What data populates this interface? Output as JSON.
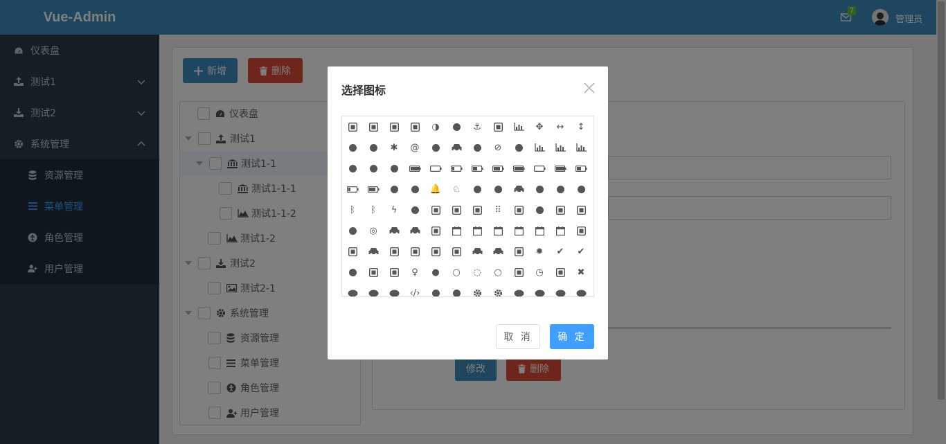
{
  "app": {
    "title": "Vue-Admin"
  },
  "sidebar": {
    "items": [
      {
        "label": "仪表盘",
        "icon": "dashboard-icon"
      },
      {
        "label": "测试1",
        "icon": "upload-icon"
      },
      {
        "label": "测试2",
        "icon": "download-icon"
      },
      {
        "label": "系统管理",
        "icon": "gear-icon"
      }
    ],
    "submenu": [
      {
        "label": "资源管理",
        "icon": "database-icon"
      },
      {
        "label": "菜单管理",
        "icon": "bars-icon",
        "active": true
      },
      {
        "label": "角色管理",
        "icon": "accessibility-icon"
      },
      {
        "label": "用户管理",
        "icon": "user-plus-icon"
      }
    ]
  },
  "header": {
    "mail_count": "7",
    "username": "管理员"
  },
  "toolbar": {
    "add_label": "新增",
    "delete_label": "删除"
  },
  "tree": {
    "nodes": [
      {
        "label": "仪表盘",
        "icon": "dashboard-icon"
      },
      {
        "label": "测试1",
        "icon": "upload-icon"
      },
      {
        "label": "测试1-1",
        "icon": "bank-icon"
      },
      {
        "label": "测试1-1-1",
        "icon": "bank-icon"
      },
      {
        "label": "测试1-1-2",
        "icon": "area-chart-icon"
      },
      {
        "label": "测试1-2",
        "icon": "area-chart-icon"
      },
      {
        "label": "测试2",
        "icon": "download-icon"
      },
      {
        "label": "测试2-1",
        "icon": "image-icon"
      },
      {
        "label": "系统管理",
        "icon": "gear-icon"
      },
      {
        "label": "资源管理",
        "icon": "database-icon"
      },
      {
        "label": "菜单管理",
        "icon": "bars-icon"
      },
      {
        "label": "角色管理",
        "icon": "accessibility-icon"
      },
      {
        "label": "用户管理",
        "icon": "user-plus-icon"
      }
    ]
  },
  "form": {
    "edit_label": "修改",
    "delete_label": "删除"
  },
  "modal": {
    "title": "选择图标",
    "cancel_label": "取 消",
    "ok_label": "确 定",
    "icons": [
      [
        "address-book-icon",
        "address-card-icon",
        "id-card-icon",
        "id-badge-icon",
        "adjust-icon",
        "sign-language-icon",
        "anchor-icon",
        "archive-icon",
        "area-chart-icon",
        "arrows-icon",
        "arrows-h-icon",
        "arrows-v-icon"
      ],
      [
        "sign-language-icon",
        "deaf-icon",
        "asterisk-icon",
        "at-icon",
        "audio-description-icon",
        "car-icon",
        "balance-scale-icon",
        "ban-icon",
        "bank-icon",
        "bar-chart-icon",
        "bar-chart-o-icon",
        "barcode-icon"
      ],
      [
        "bars-icon",
        "bath-icon",
        "bathtub-icon",
        "battery-full-icon",
        "battery-empty-icon",
        "battery-quarter-icon",
        "battery-half-icon",
        "battery-three-quarters-icon",
        "battery-full-icon",
        "battery-empty-icon",
        "battery-full-icon",
        "battery-half-icon"
      ],
      [
        "battery-quarter-icon",
        "battery-three-quarters-icon",
        "bed-icon",
        "beer-icon",
        "bell-icon",
        "bell-o-icon",
        "bell-slash-icon",
        "bell-slash-o-icon",
        "bicycle-icon",
        "binoculars-icon",
        "birthday-cake-icon",
        "blind-icon"
      ],
      [
        "bluetooth-icon",
        "bluetooth-b-icon",
        "bolt-icon",
        "bomb-icon",
        "book-icon",
        "bookmark-icon",
        "bookmark-o-icon",
        "braille-icon",
        "briefcase-icon",
        "bug-icon",
        "building-icon",
        "building-o-icon"
      ],
      [
        "bullhorn-icon",
        "bullseye-icon",
        "bus-icon",
        "taxi-icon",
        "calculator-icon",
        "calendar-icon",
        "calendar-check-icon",
        "calendar-minus-icon",
        "calendar-o-icon",
        "calendar-plus-icon",
        "calendar-times-icon",
        "camera-icon"
      ],
      [
        "camera-retro-icon",
        "car-icon",
        "caret-square-down-icon",
        "caret-square-left-icon",
        "caret-square-right-icon",
        "caret-square-up-icon",
        "cart-arrow-down-icon",
        "cart-plus-icon",
        "cc-icon",
        "certificate-icon",
        "check-icon",
        "check-circle-icon"
      ],
      [
        "check-circle-o-icon",
        "check-square-icon",
        "check-square-o-icon",
        "child-icon",
        "circle-icon",
        "circle-o-icon",
        "circle-o-notch-icon",
        "circle-thin-icon",
        "clipboard-icon",
        "clock-icon",
        "clone-icon",
        "close-icon"
      ],
      [
        "cloud-icon",
        "cloud-download-icon",
        "cloud-upload-icon",
        "code-icon",
        "code-fork-icon",
        "coffee-icon",
        "cog-icon",
        "cogs-icon",
        "comment-icon",
        "comment-o-icon",
        "commenting-icon",
        "commenting-o-icon"
      ]
    ]
  }
}
